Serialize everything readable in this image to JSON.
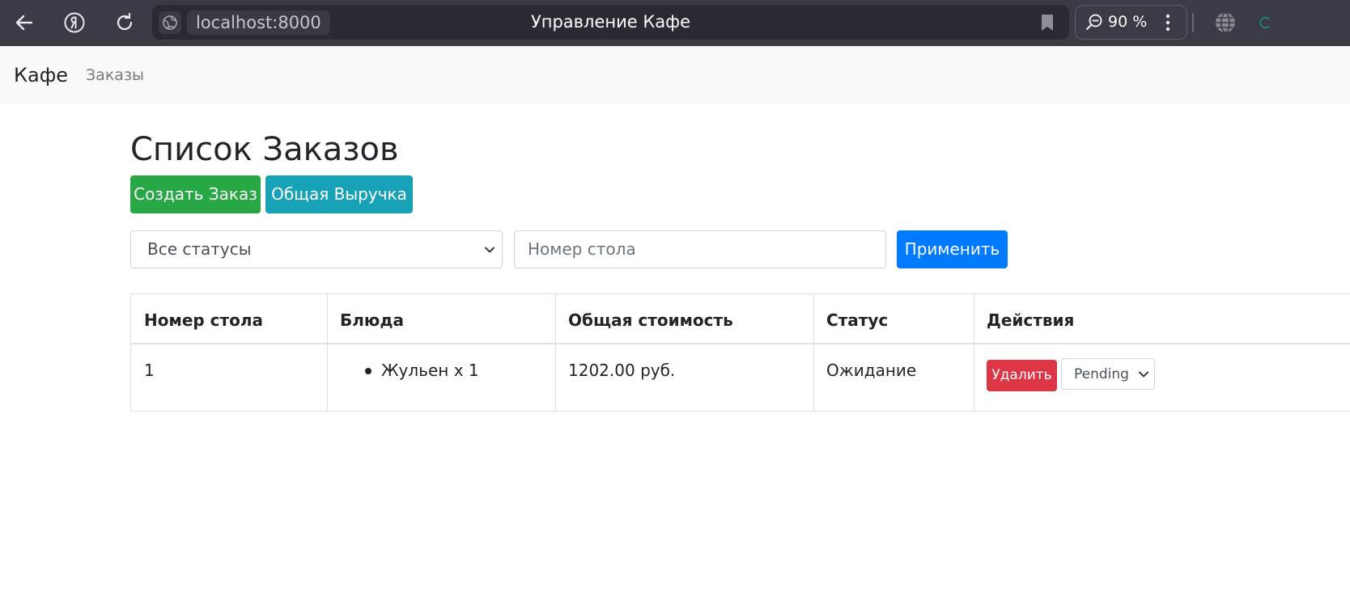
{
  "browser": {
    "url_host": "localhost:8000",
    "page_title": "Управление Кафе",
    "zoom": "90 %"
  },
  "navbar": {
    "brand": "Кафе",
    "links": [
      "Заказы"
    ]
  },
  "main": {
    "heading": "Список Заказов",
    "create_button": "Создать Заказ",
    "revenue_button": "Общая Выручка",
    "filter": {
      "status_selected": "Все статусы",
      "table_placeholder": "Номер стола",
      "apply_button": "Применить"
    },
    "table": {
      "headers": [
        "Номер стола",
        "Блюда",
        "Общая стоимость",
        "Статус",
        "Действия"
      ],
      "rows": [
        {
          "table_number": "1",
          "dishes": [
            "Жульен x 1"
          ],
          "total": "1202.00 руб.",
          "status": "Ожидание",
          "delete_label": "Удалить",
          "status_select": "Pending"
        }
      ]
    }
  },
  "colors": {
    "success": "#28a745",
    "info": "#17a2b8",
    "primary": "#007bff",
    "danger": "#dc3545"
  }
}
